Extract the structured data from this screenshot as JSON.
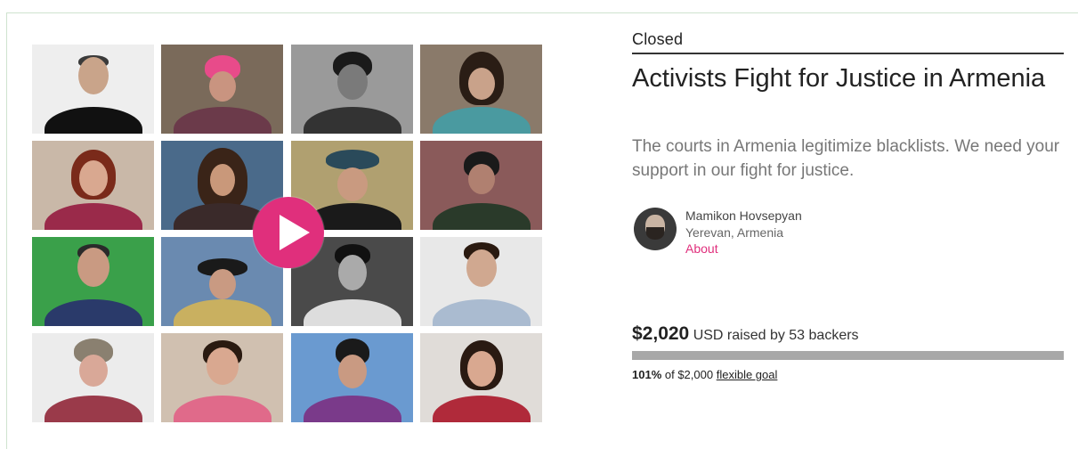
{
  "campaign": {
    "status": "Closed",
    "title": "Activists Fight for Justice in Armenia",
    "blurb": "The courts in Armenia legitimize blacklists. We need your support in our fight for justice.",
    "creator": {
      "name": "Mamikon Hovsepyan",
      "location": "Yerevan, Armenia",
      "about_label": "About"
    },
    "funding": {
      "amount": "$2,020",
      "raised_text": "USD raised by 53 backers",
      "percent_label": "101%",
      "goal_text": "of $2,000",
      "goal_type": "flexible goal",
      "progress_fraction": 1.0
    }
  },
  "colors": {
    "accent": "#e02f7c",
    "progress_fill": "#a8a8a8",
    "card_border": "#cfe3cf"
  },
  "icons": {
    "play": "play-icon"
  }
}
